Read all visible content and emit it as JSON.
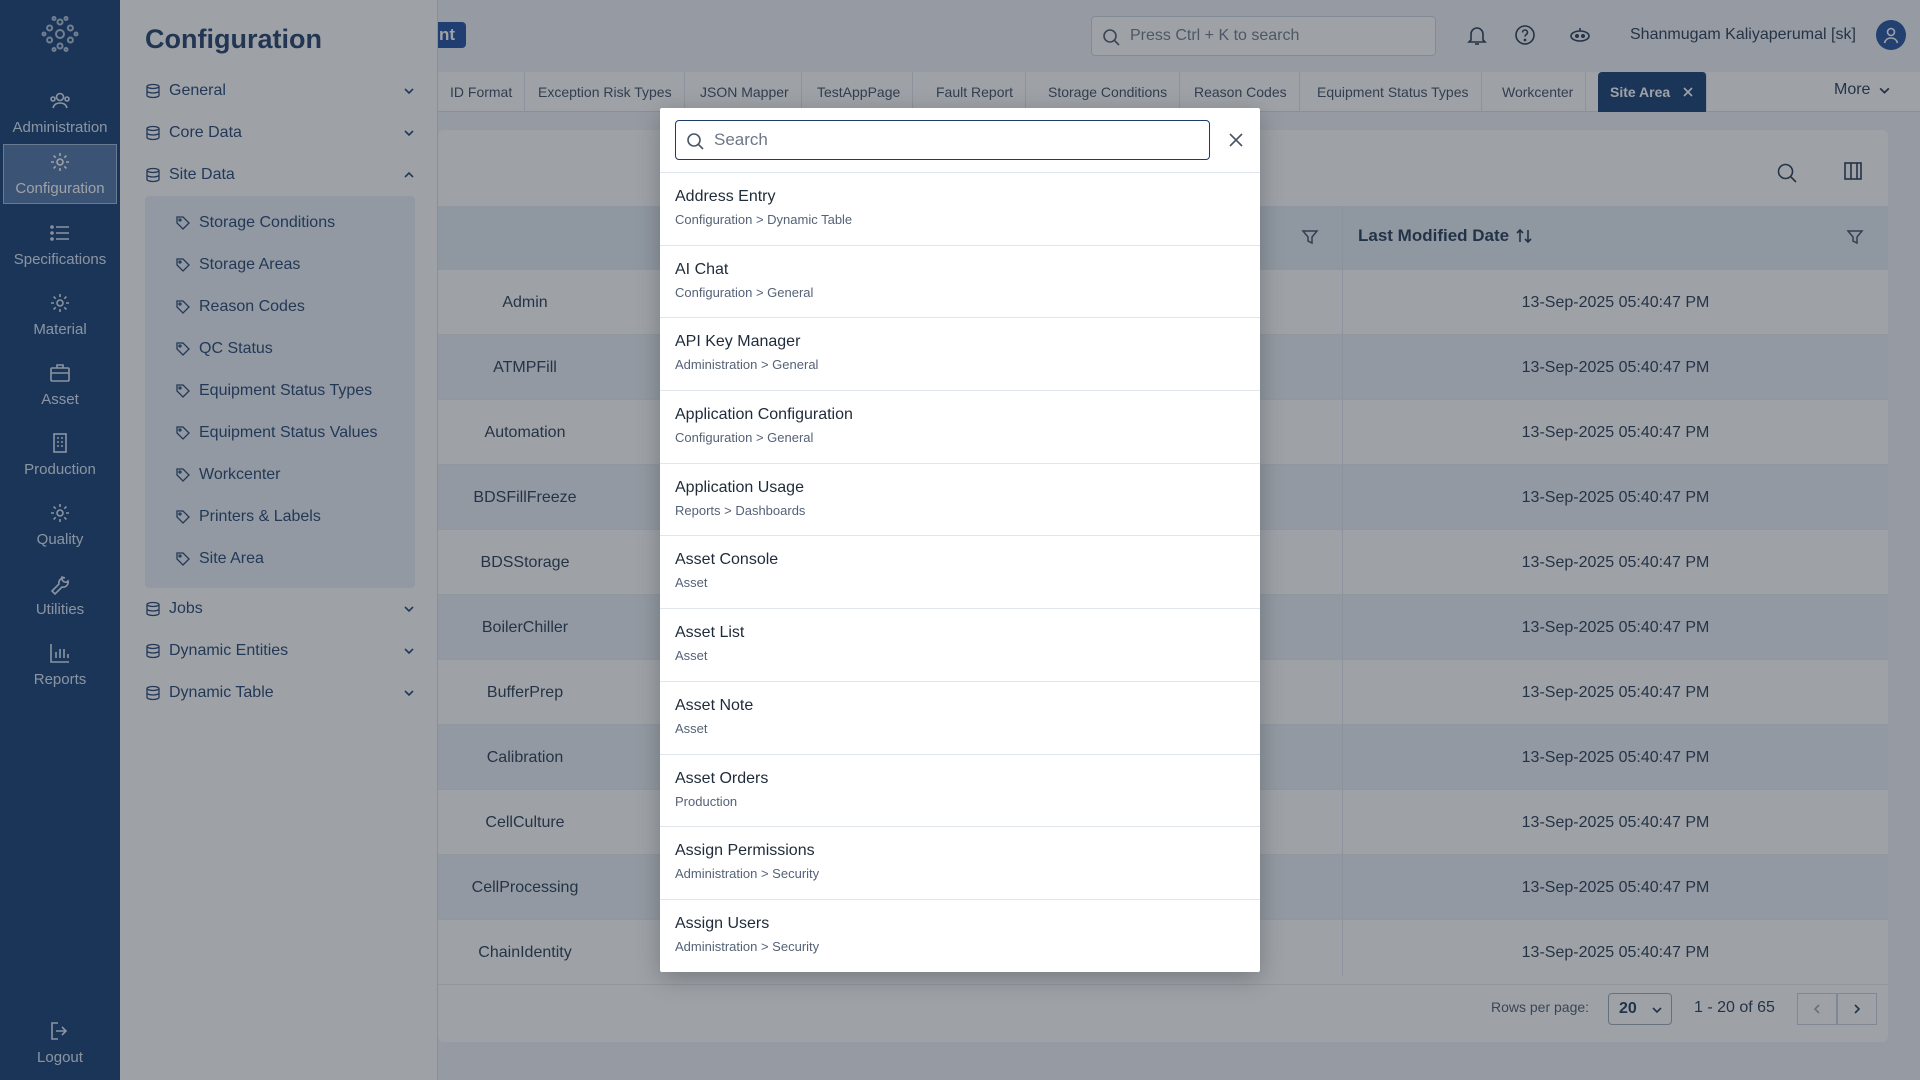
{
  "rail": {
    "items": [
      {
        "label": "Administration",
        "icon": "users-icon"
      },
      {
        "label": "Configuration",
        "icon": "gear-icon",
        "active": true
      },
      {
        "label": "Specifications",
        "icon": "list-icon"
      },
      {
        "label": "Material",
        "icon": "gear-icon"
      },
      {
        "label": "Asset",
        "icon": "briefcase-icon"
      },
      {
        "label": "Production",
        "icon": "building-icon"
      },
      {
        "label": "Quality",
        "icon": "gear-icon"
      },
      {
        "label": "Utilities",
        "icon": "wrench-icon"
      },
      {
        "label": "Reports",
        "icon": "bar-chart-icon"
      }
    ],
    "logout": "Logout"
  },
  "config": {
    "title": "Configuration",
    "groups": {
      "general": "General",
      "core_data": "Core Data",
      "site_data": "Site Data",
      "jobs": "Jobs",
      "dynamic_entities": "Dynamic Entities",
      "dynamic_table": "Dynamic Table"
    },
    "site_items": [
      "Storage Conditions",
      "Storage Areas",
      "Reason Codes",
      "QC Status",
      "Equipment Status Types",
      "Equipment Status Values",
      "Workcenter",
      "Printers & Labels",
      "Site Area"
    ]
  },
  "header": {
    "badge": "nt",
    "search_placeholder": "Press Ctrl + K to search",
    "user": "Shanmugam Kaliyaperumal [sk]"
  },
  "tabs": [
    "ID Format",
    "Exception Risk Types",
    "JSON Mapper",
    "TestAppPage",
    "Fault Report",
    "Storage Conditions",
    "Reason Codes",
    "Equipment Status Types",
    "Workcenter",
    "Site Area"
  ],
  "more_label": "More",
  "table": {
    "last_modified_header": "Last Modified Date",
    "rows": [
      {
        "name": "Admin",
        "date": "13-Sep-2025 05:40:47 PM"
      },
      {
        "name": "ATMPFill",
        "date": "13-Sep-2025 05:40:47 PM"
      },
      {
        "name": "Automation",
        "date": "13-Sep-2025 05:40:47 PM"
      },
      {
        "name": "BDSFillFreeze",
        "date": "13-Sep-2025 05:40:47 PM"
      },
      {
        "name": "BDSStorage",
        "date": "13-Sep-2025 05:40:47 PM"
      },
      {
        "name": "BoilerChiller",
        "date": "13-Sep-2025 05:40:47 PM"
      },
      {
        "name": "BufferPrep",
        "date": "13-Sep-2025 05:40:47 PM"
      },
      {
        "name": "Calibration",
        "date": "13-Sep-2025 05:40:47 PM"
      },
      {
        "name": "CellCulture",
        "date": "13-Sep-2025 05:40:47 PM"
      },
      {
        "name": "CellProcessing",
        "date": "13-Sep-2025 05:40:47 PM"
      },
      {
        "name": "ChainIdentity",
        "date": "13-Sep-2025 05:40:47 PM"
      }
    ]
  },
  "pager": {
    "rows_per_page_label": "Rows per page:",
    "rows_per_page": "20",
    "range": "1 - 20 of 65"
  },
  "modal": {
    "search_placeholder": "Search",
    "search_value": "",
    "results": [
      {
        "title": "Address Entry",
        "path": "Configuration > Dynamic Table"
      },
      {
        "title": "AI Chat",
        "path": "Configuration > General"
      },
      {
        "title": "API Key Manager",
        "path": "Administration > General"
      },
      {
        "title": "Application Configuration",
        "path": "Configuration > General"
      },
      {
        "title": "Application Usage",
        "path": "Reports > Dashboards"
      },
      {
        "title": "Asset Console",
        "path": "Asset"
      },
      {
        "title": "Asset List",
        "path": "Asset"
      },
      {
        "title": "Asset Note",
        "path": "Asset"
      },
      {
        "title": "Asset Orders",
        "path": "Production"
      },
      {
        "title": "Assign Permissions",
        "path": "Administration > Security"
      },
      {
        "title": "Assign Users",
        "path": "Administration > Security"
      }
    ]
  },
  "colors": {
    "rail_bg": "#123a70",
    "accent": "#1e3a66",
    "active_tab": "#123a70",
    "badge": "#1d4aa0"
  }
}
